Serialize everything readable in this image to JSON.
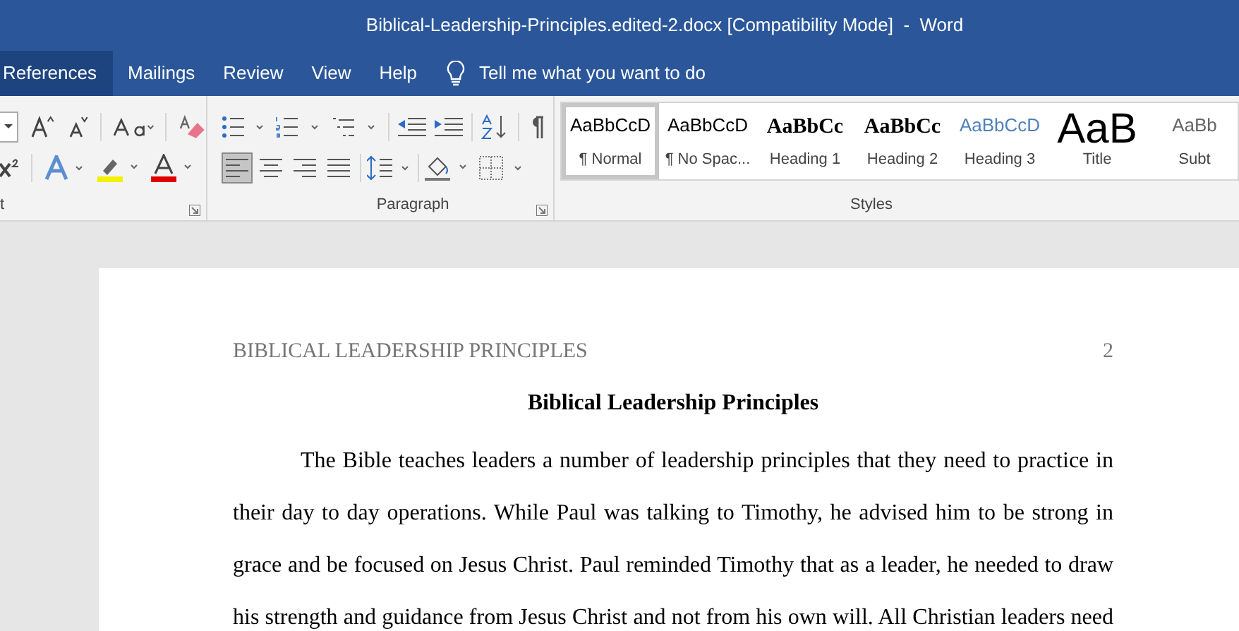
{
  "window": {
    "title": "Biblical-Leadership-Principles.edited-2.docx [Compatibility Mode]  -  Word"
  },
  "tabs": [
    {
      "label": "References",
      "selected": true
    },
    {
      "label": "Mailings",
      "selected": false
    },
    {
      "label": "Review",
      "selected": false
    },
    {
      "label": "View",
      "selected": false
    },
    {
      "label": "Help",
      "selected": false
    }
  ],
  "tell_me": {
    "placeholder": "Tell me what you want to do"
  },
  "ribbon": {
    "font_group": {
      "label": "t"
    },
    "paragraph_group": {
      "label": "Paragraph",
      "alignments": [
        {
          "selected": true
        },
        {
          "selected": false
        },
        {
          "selected": false
        },
        {
          "selected": false
        }
      ]
    },
    "styles_group": {
      "label": "Styles",
      "styles": [
        {
          "preview": "AaBbCcD",
          "name": "¶ Normal",
          "kind": "normal",
          "selected": true
        },
        {
          "preview": "AaBbCcD",
          "name": "¶ No Spac...",
          "kind": "normal",
          "selected": false
        },
        {
          "preview": "AaBbCc",
          "name": "Heading 1",
          "kind": "heading1",
          "selected": false
        },
        {
          "preview": "AaBbCc",
          "name": "Heading 2",
          "kind": "heading2",
          "selected": false
        },
        {
          "preview": "AaBbCcD",
          "name": "Heading 3",
          "kind": "heading3",
          "selected": false
        },
        {
          "preview": "AaB",
          "name": "Title",
          "kind": "title",
          "selected": false
        },
        {
          "preview": "AaBb",
          "name": "Subt",
          "kind": "subtitle",
          "selected": false
        }
      ]
    }
  },
  "document": {
    "header": "BIBLICAL LEADERSHIP PRINCIPLES",
    "page_number": "2",
    "title": "Biblical Leadership Principles",
    "paragraph": "The Bible teaches leaders a number of leadership principles that they need to practice in their day to day operations. While Paul was talking to Timothy, he advised him to be strong in grace and be focused on Jesus Christ. Paul reminded Timothy that as a leader, he needed to draw his strength and guidance from Jesus Christ and not from his own will. All Christian leaders need"
  }
}
